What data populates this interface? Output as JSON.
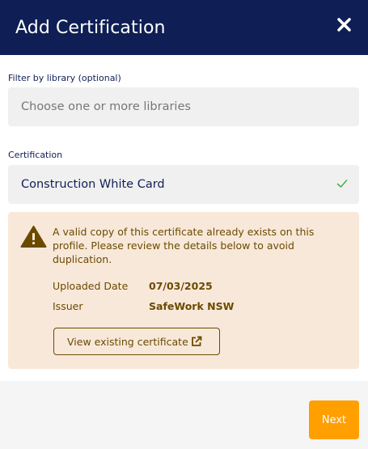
{
  "modal": {
    "title": "Add Certification",
    "close_icon": "close-icon"
  },
  "filter": {
    "label": "Filter by library (optional)",
    "placeholder": "Choose one or more libraries"
  },
  "certification": {
    "label": "Certification",
    "value": "Construction White Card",
    "status_icon": "checkmark-icon"
  },
  "warning": {
    "icon": "warning-triangle-icon",
    "message": "A valid copy of this certificate already exists on this profile. Please review the details below to avoid duplication.",
    "details": [
      {
        "label": "Uploaded Date",
        "value": "07/03/2025"
      },
      {
        "label": "Issuer",
        "value": "SafeWork NSW"
      }
    ],
    "view_button_label": "View existing certificate",
    "view_button_icon": "external-link-icon"
  },
  "footer": {
    "next_label": "Next"
  },
  "colors": {
    "header_bg": "#0f1f55",
    "accent": "#ff9f00",
    "warning_bg": "#f8e8da",
    "warning_text": "#6b4a00",
    "success": "#4caf50"
  }
}
